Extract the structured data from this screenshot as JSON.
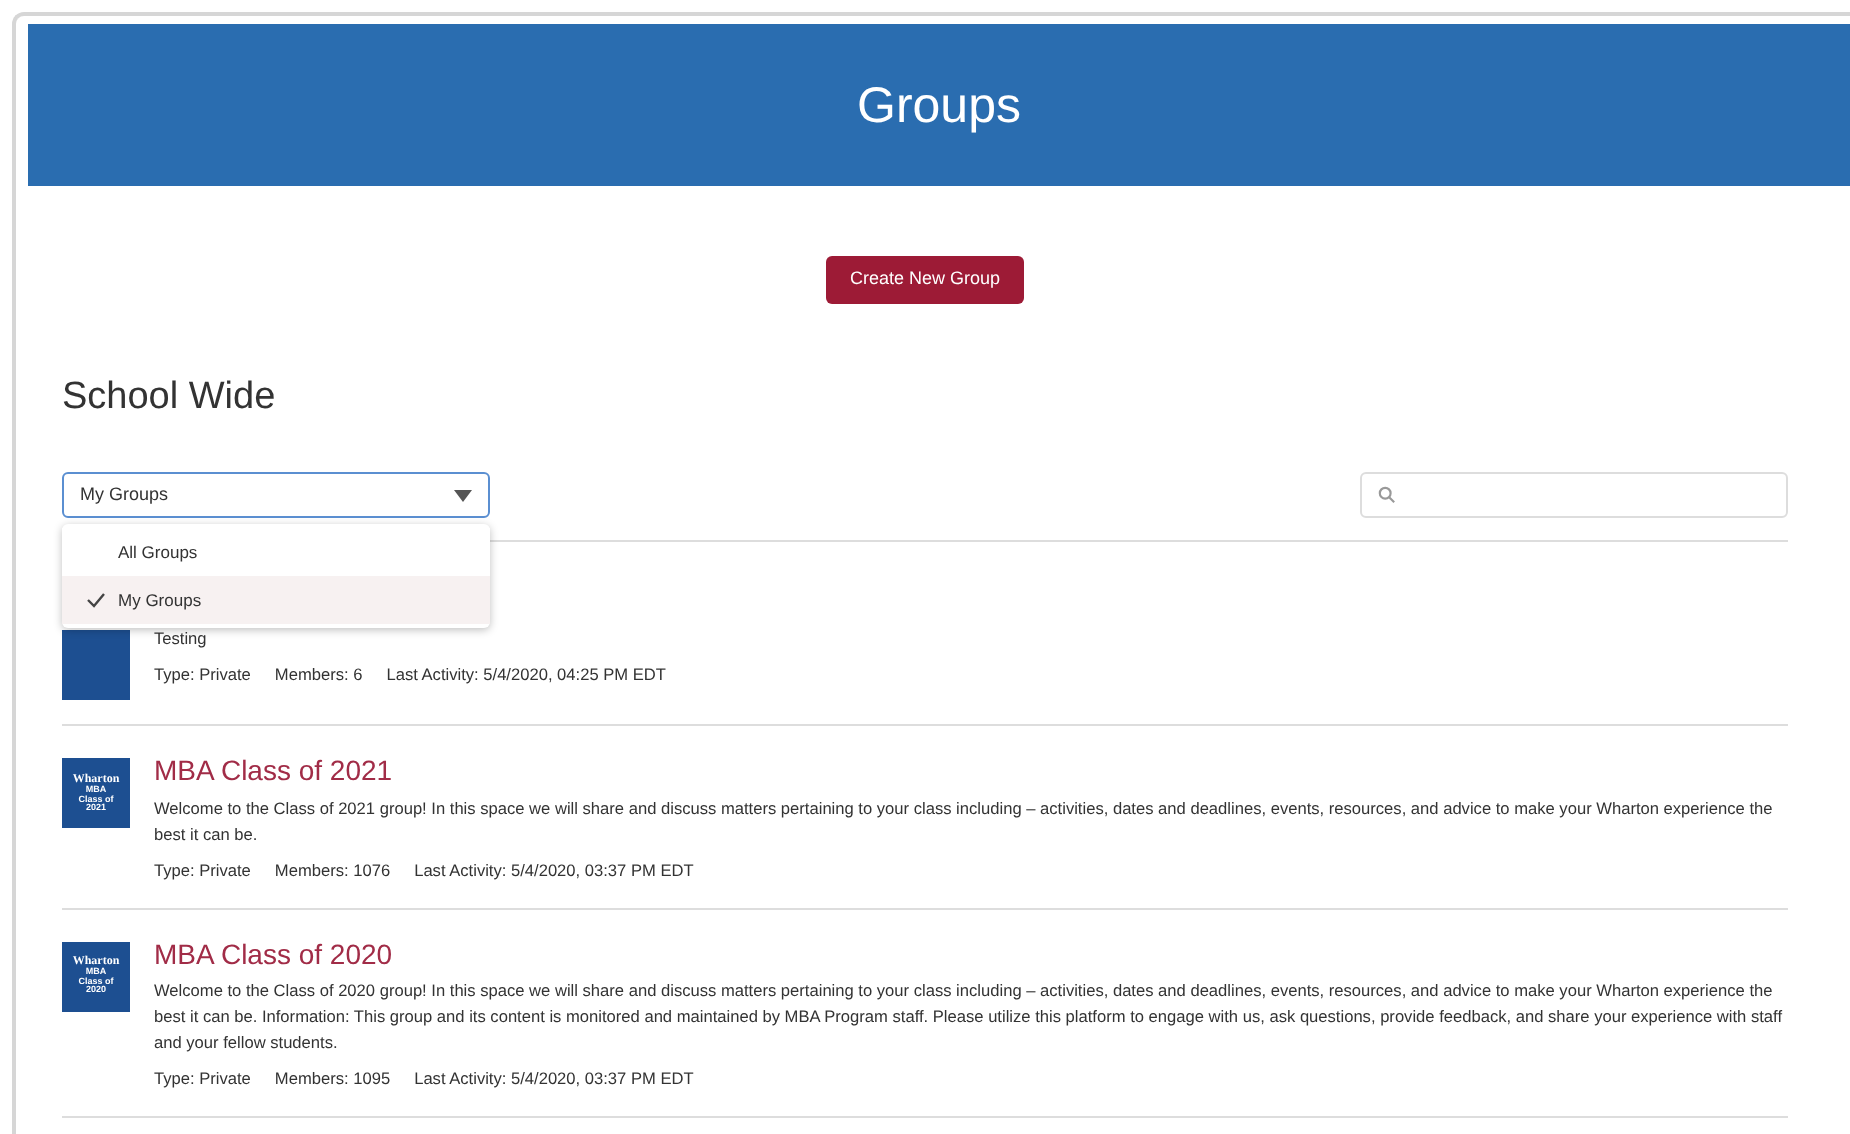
{
  "header": {
    "title": "Groups"
  },
  "create_button": "Create New Group",
  "section_title": "School Wide",
  "filter": {
    "value": "My Groups",
    "expanded": true,
    "options": [
      {
        "label": "All Groups",
        "selected": false
      },
      {
        "label": "My Groups",
        "selected": true
      }
    ]
  },
  "groups": [
    {
      "description": "Testing",
      "type": "Type: Private",
      "members": "Members: 6",
      "last_activity": "Last Activity: 5/4/2020, 04:25 PM EDT"
    },
    {
      "name": "MBA Class of 2021",
      "logo": {
        "lines": [
          "Wharton",
          "MBA",
          "Class of",
          "2021"
        ]
      },
      "description": "Welcome to the Class of 2021 group! In this space we will share and discuss matters pertaining to your class including – activities, dates and deadlines, events, resources, and advice to make your Wharton experience the best it can be.",
      "type": "Type: Private",
      "members": "Members: 1076",
      "last_activity": "Last Activity: 5/4/2020, 03:37 PM EDT"
    },
    {
      "name": "MBA Class of 2020",
      "logo": {
        "lines": [
          "Wharton",
          "MBA",
          "Class of",
          "2020"
        ]
      },
      "description": "Welcome to the Class of 2020 group! In this space we will share and discuss matters pertaining to your class including – activities, dates and deadlines, events, resources, and advice to make your Wharton experience the best it can be. Information: This group and its content is monitored and maintained by MBA Program staff. Please utilize this platform to engage with us, ask questions, provide feedback, and share your experience with staff and your fellow students.",
      "type": "Type: Private",
      "members": "Members: 1095",
      "last_activity": "Last Activity: 5/4/2020, 03:37 PM EDT"
    }
  ]
}
